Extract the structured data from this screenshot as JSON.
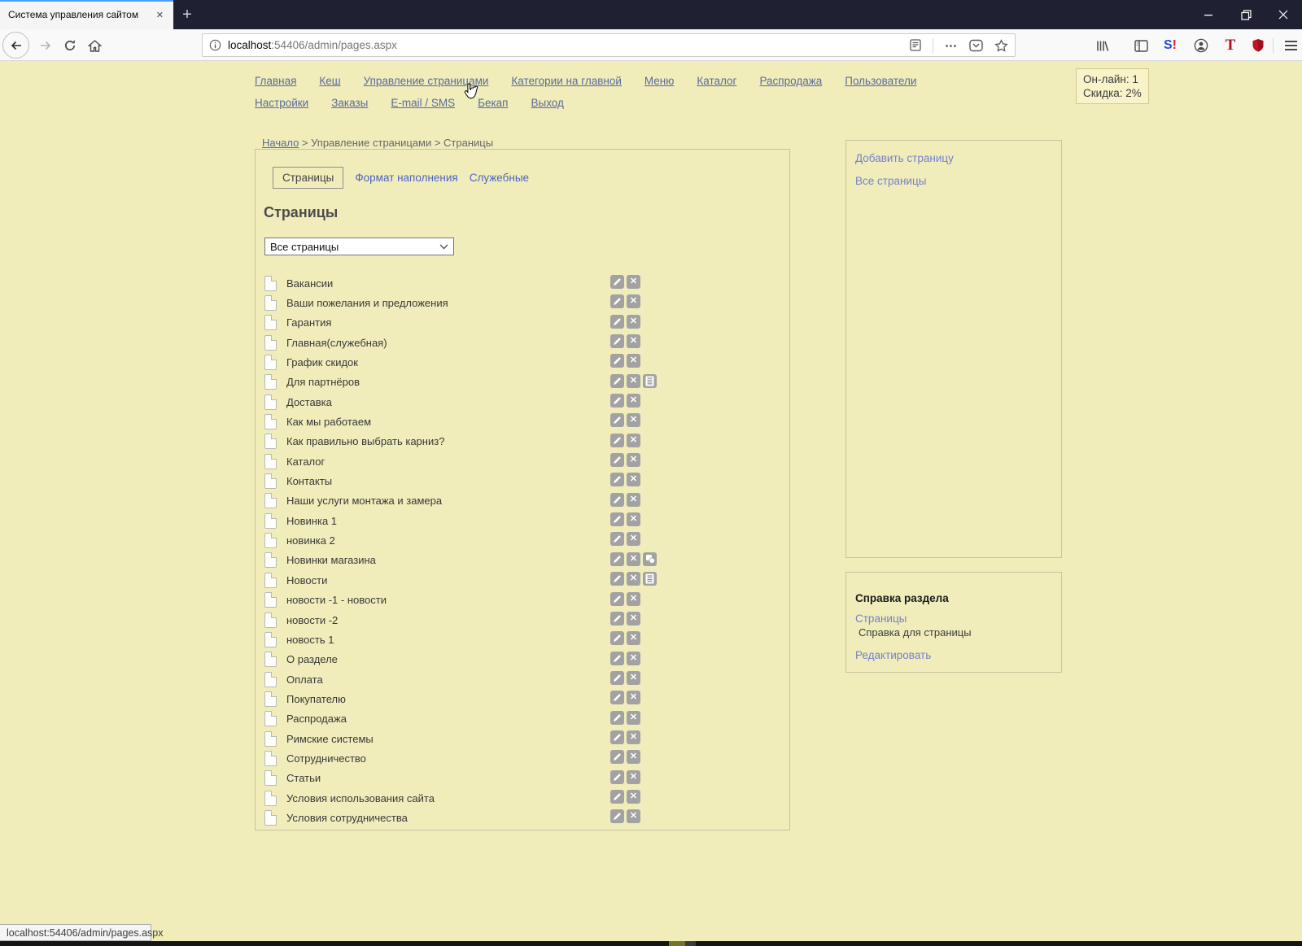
{
  "browser": {
    "tab_title": "Система управления сайтом",
    "tab_close_glyph": "✕",
    "new_tab_glyph": "+",
    "url": {
      "domain": "localhost",
      "rest": ":54406/admin/pages.aspx"
    },
    "status_text": "localhost:54406/admin/pages.aspx",
    "page_actions_glyph": "⋯",
    "extensions": {
      "s_letter": "S",
      "s_bang": "!",
      "t_letter": "T"
    }
  },
  "nav": {
    "row1": [
      "Главная",
      "Кеш",
      "Управление страницами",
      "Категории на главной",
      "Меню",
      "Каталог",
      "Распродажа",
      "Пользователи"
    ],
    "row2": [
      "Настройки",
      "Заказы",
      "E-mail / SMS",
      "Бекап",
      "Выход"
    ]
  },
  "online_box": {
    "line1": "Он-лайн: 1",
    "line2": "Скидка: 2%"
  },
  "breadcrumb": {
    "home": "Начало",
    "rest": " > Управление страницами > Страницы"
  },
  "section_tabs": [
    {
      "label": "Страницы",
      "active": true
    },
    {
      "label": "Формат наполнения",
      "active": false
    },
    {
      "label": "Служебные",
      "active": false
    }
  ],
  "main": {
    "heading": "Страницы",
    "filter_value": "Все страницы"
  },
  "pages_list": [
    {
      "name": "Вакансии",
      "extra": null
    },
    {
      "name": "Ваши пожелания и предложения",
      "extra": null
    },
    {
      "name": "Гарантия",
      "extra": null
    },
    {
      "name": "Главная(служебная)",
      "extra": null
    },
    {
      "name": "График скидок",
      "extra": null
    },
    {
      "name": "Для партнёров",
      "extra": "list"
    },
    {
      "name": "Доставка",
      "extra": null
    },
    {
      "name": "Как мы работаем",
      "extra": null
    },
    {
      "name": "Как правильно выбрать карниз?",
      "extra": null
    },
    {
      "name": "Каталог",
      "extra": null
    },
    {
      "name": "Контакты",
      "extra": null
    },
    {
      "name": "Наши услуги монтажа и замера",
      "extra": null
    },
    {
      "name": "Новинка 1",
      "extra": null
    },
    {
      "name": "новинка 2",
      "extra": null
    },
    {
      "name": "Новинки магазина",
      "extra": "copy"
    },
    {
      "name": "Новости",
      "extra": "list"
    },
    {
      "name": "новости -1 - новости",
      "extra": null
    },
    {
      "name": "новости -2",
      "extra": null
    },
    {
      "name": "новость 1",
      "extra": null
    },
    {
      "name": "О разделе",
      "extra": null
    },
    {
      "name": "Оплата",
      "extra": null
    },
    {
      "name": "Покупателю",
      "extra": null
    },
    {
      "name": "Распродажа",
      "extra": null
    },
    {
      "name": "Римские системы",
      "extra": null
    },
    {
      "name": "Сотрудничество",
      "extra": null
    },
    {
      "name": "Статьи",
      "extra": null
    },
    {
      "name": "Условия использования сайта",
      "extra": null
    },
    {
      "name": "Условия сотрудничества",
      "extra": null
    }
  ],
  "sidebar": {
    "links": [
      "Добавить страницу",
      "Все страницы"
    ]
  },
  "help_box": {
    "title": "Справка раздела",
    "link1": "Страницы",
    "text": "Справка для страницы",
    "link2": "Редактировать"
  },
  "colors": {
    "page_bg": "#f0edbb",
    "nav_link": "#5a6a99",
    "tab_link": "#4f63c2",
    "sidebar_link": "#7581cb",
    "button_gray": "#a2a2a2",
    "tab_highlight": "#45a1ff",
    "tabbar_bg": "#1f2133"
  }
}
